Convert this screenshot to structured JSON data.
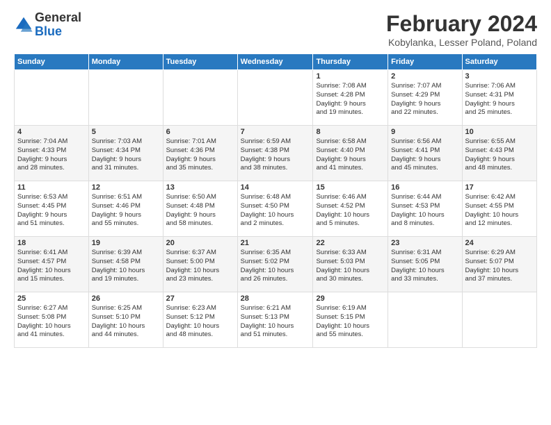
{
  "header": {
    "logo_general": "General",
    "logo_blue": "Blue",
    "month_title": "February 2024",
    "location": "Kobylanka, Lesser Poland, Poland"
  },
  "weekdays": [
    "Sunday",
    "Monday",
    "Tuesday",
    "Wednesday",
    "Thursday",
    "Friday",
    "Saturday"
  ],
  "weeks": [
    [
      {
        "day": "",
        "info": ""
      },
      {
        "day": "",
        "info": ""
      },
      {
        "day": "",
        "info": ""
      },
      {
        "day": "",
        "info": ""
      },
      {
        "day": "1",
        "info": "Sunrise: 7:08 AM\nSunset: 4:28 PM\nDaylight: 9 hours\nand 19 minutes."
      },
      {
        "day": "2",
        "info": "Sunrise: 7:07 AM\nSunset: 4:29 PM\nDaylight: 9 hours\nand 22 minutes."
      },
      {
        "day": "3",
        "info": "Sunrise: 7:06 AM\nSunset: 4:31 PM\nDaylight: 9 hours\nand 25 minutes."
      }
    ],
    [
      {
        "day": "4",
        "info": "Sunrise: 7:04 AM\nSunset: 4:33 PM\nDaylight: 9 hours\nand 28 minutes."
      },
      {
        "day": "5",
        "info": "Sunrise: 7:03 AM\nSunset: 4:34 PM\nDaylight: 9 hours\nand 31 minutes."
      },
      {
        "day": "6",
        "info": "Sunrise: 7:01 AM\nSunset: 4:36 PM\nDaylight: 9 hours\nand 35 minutes."
      },
      {
        "day": "7",
        "info": "Sunrise: 6:59 AM\nSunset: 4:38 PM\nDaylight: 9 hours\nand 38 minutes."
      },
      {
        "day": "8",
        "info": "Sunrise: 6:58 AM\nSunset: 4:40 PM\nDaylight: 9 hours\nand 41 minutes."
      },
      {
        "day": "9",
        "info": "Sunrise: 6:56 AM\nSunset: 4:41 PM\nDaylight: 9 hours\nand 45 minutes."
      },
      {
        "day": "10",
        "info": "Sunrise: 6:55 AM\nSunset: 4:43 PM\nDaylight: 9 hours\nand 48 minutes."
      }
    ],
    [
      {
        "day": "11",
        "info": "Sunrise: 6:53 AM\nSunset: 4:45 PM\nDaylight: 9 hours\nand 51 minutes."
      },
      {
        "day": "12",
        "info": "Sunrise: 6:51 AM\nSunset: 4:46 PM\nDaylight: 9 hours\nand 55 minutes."
      },
      {
        "day": "13",
        "info": "Sunrise: 6:50 AM\nSunset: 4:48 PM\nDaylight: 9 hours\nand 58 minutes."
      },
      {
        "day": "14",
        "info": "Sunrise: 6:48 AM\nSunset: 4:50 PM\nDaylight: 10 hours\nand 2 minutes."
      },
      {
        "day": "15",
        "info": "Sunrise: 6:46 AM\nSunset: 4:52 PM\nDaylight: 10 hours\nand 5 minutes."
      },
      {
        "day": "16",
        "info": "Sunrise: 6:44 AM\nSunset: 4:53 PM\nDaylight: 10 hours\nand 8 minutes."
      },
      {
        "day": "17",
        "info": "Sunrise: 6:42 AM\nSunset: 4:55 PM\nDaylight: 10 hours\nand 12 minutes."
      }
    ],
    [
      {
        "day": "18",
        "info": "Sunrise: 6:41 AM\nSunset: 4:57 PM\nDaylight: 10 hours\nand 15 minutes."
      },
      {
        "day": "19",
        "info": "Sunrise: 6:39 AM\nSunset: 4:58 PM\nDaylight: 10 hours\nand 19 minutes."
      },
      {
        "day": "20",
        "info": "Sunrise: 6:37 AM\nSunset: 5:00 PM\nDaylight: 10 hours\nand 23 minutes."
      },
      {
        "day": "21",
        "info": "Sunrise: 6:35 AM\nSunset: 5:02 PM\nDaylight: 10 hours\nand 26 minutes."
      },
      {
        "day": "22",
        "info": "Sunrise: 6:33 AM\nSunset: 5:03 PM\nDaylight: 10 hours\nand 30 minutes."
      },
      {
        "day": "23",
        "info": "Sunrise: 6:31 AM\nSunset: 5:05 PM\nDaylight: 10 hours\nand 33 minutes."
      },
      {
        "day": "24",
        "info": "Sunrise: 6:29 AM\nSunset: 5:07 PM\nDaylight: 10 hours\nand 37 minutes."
      }
    ],
    [
      {
        "day": "25",
        "info": "Sunrise: 6:27 AM\nSunset: 5:08 PM\nDaylight: 10 hours\nand 41 minutes."
      },
      {
        "day": "26",
        "info": "Sunrise: 6:25 AM\nSunset: 5:10 PM\nDaylight: 10 hours\nand 44 minutes."
      },
      {
        "day": "27",
        "info": "Sunrise: 6:23 AM\nSunset: 5:12 PM\nDaylight: 10 hours\nand 48 minutes."
      },
      {
        "day": "28",
        "info": "Sunrise: 6:21 AM\nSunset: 5:13 PM\nDaylight: 10 hours\nand 51 minutes."
      },
      {
        "day": "29",
        "info": "Sunrise: 6:19 AM\nSunset: 5:15 PM\nDaylight: 10 hours\nand 55 minutes."
      },
      {
        "day": "",
        "info": ""
      },
      {
        "day": "",
        "info": ""
      }
    ]
  ]
}
